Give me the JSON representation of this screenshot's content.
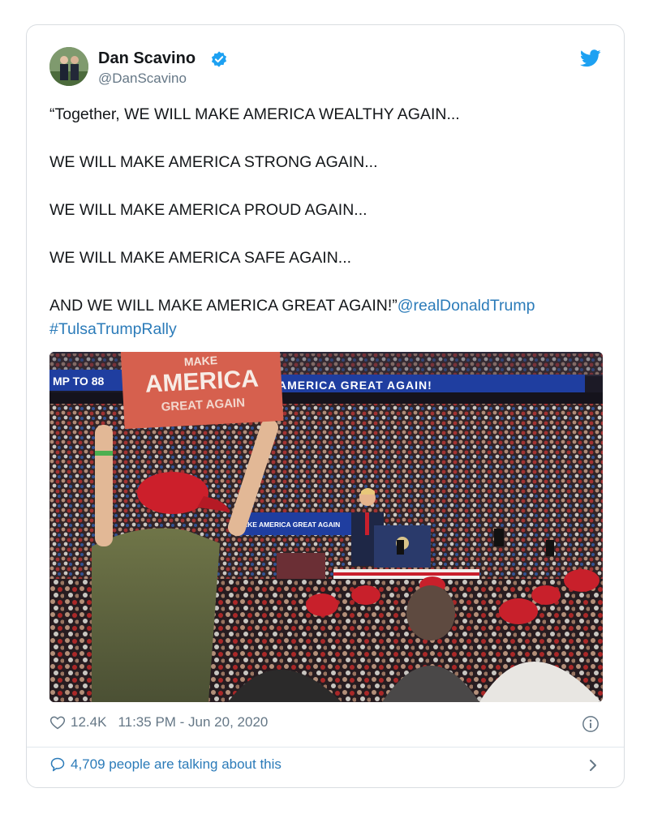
{
  "tweet": {
    "author_name": "Dan Scavino",
    "author_handle": "@DanScavino",
    "lines": [
      "“Together, WE WILL MAKE AMERICA WEALTHY AGAIN...",
      "WE WILL MAKE AMERICA STRONG AGAIN...",
      "WE WILL MAKE AMERICA PROUD AGAIN...",
      "WE WILL MAKE AMERICA SAFE AGAIN..."
    ],
    "last_line": "AND WE WILL MAKE AMERICA GREAT AGAIN!”",
    "mention": "@realDonaldTrump",
    "hashtag": "#TulsaTrumpRally",
    "likes": "12.4K",
    "timestamp": "11:35 PM - Jun 20, 2020",
    "talking": "4,709 people are talking about this"
  },
  "photo": {
    "sign_lines": [
      "MAKE",
      "AMERICA",
      "GREAT AGAIN"
    ],
    "banner_left": "MP TO 88",
    "banner_right": "AMERICA GREAT AGAIN!",
    "stage_banner": "AKE AMERICA GREAT AGAIN"
  },
  "colors": {
    "link": "#2b7bb9",
    "verified": "#1da1f2",
    "twitter_bird": "#1da1f2",
    "muted": "#657786"
  },
  "icons": [
    "verified-badge-icon",
    "twitter-bird-icon",
    "heart-icon",
    "info-icon",
    "speech-bubble-icon",
    "chevron-right-icon"
  ]
}
